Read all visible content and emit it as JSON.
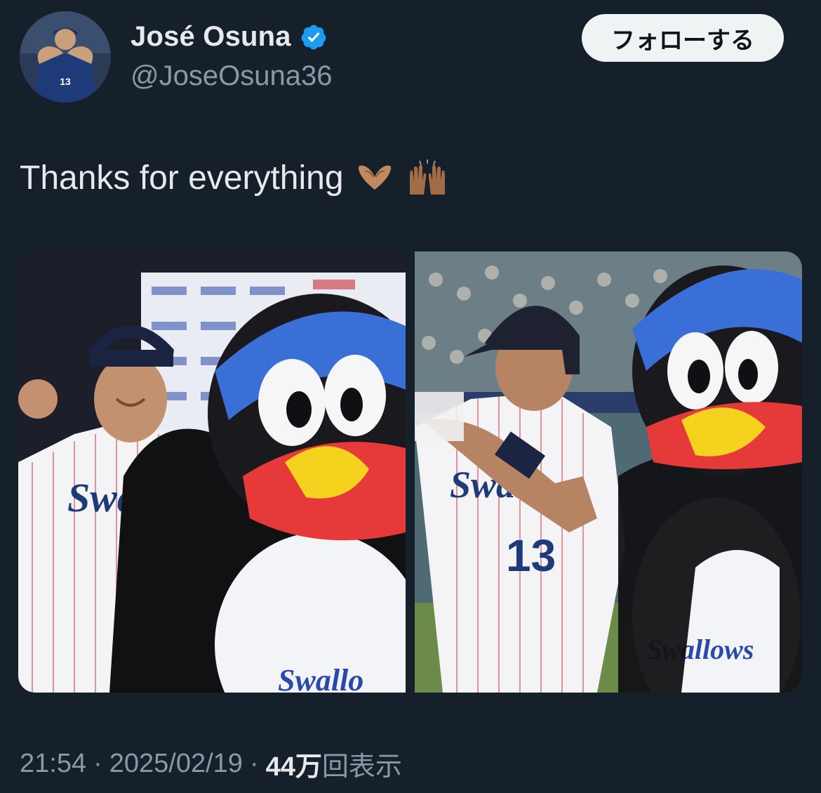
{
  "author": {
    "display_name": "José Osuna",
    "handle": "@JoseOsuna36",
    "verified": true,
    "avatar_icon": "player-avatar"
  },
  "follow_button": {
    "label": "フォローする"
  },
  "tweet": {
    "text": "Thanks for everything",
    "emojis": [
      "heart-hands-emoji",
      "raising-hands-emoji"
    ]
  },
  "media": [
    {
      "name": "photo-player-with-mascot-1",
      "icon": "photo"
    },
    {
      "name": "photo-player-with-mascot-2",
      "icon": "photo"
    }
  ],
  "meta": {
    "time": "21:54",
    "separator": "·",
    "date": "2025/02/19",
    "views_count": "44万",
    "views_label": "回表示"
  },
  "colors": {
    "background": "#15202b",
    "verified_badge": "#1d9bf0",
    "secondary_text": "#8b98a5",
    "primary_text": "#e7e9ea",
    "follow_button_bg": "#eff3f4"
  }
}
